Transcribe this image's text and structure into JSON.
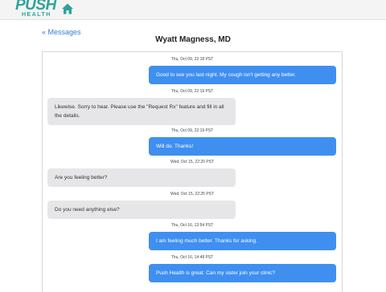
{
  "header": {
    "logo_top": "PUSH",
    "logo_bottom": "HEALTH",
    "home_icon": "home-icon"
  },
  "nav": {
    "back_label": "« Messages"
  },
  "conversation": {
    "title": "Wyatt Magness, MD",
    "messages": [
      {
        "timestamp": "Thu, Oct 09, 22:18 PST",
        "direction": "sent",
        "text": "Good to see you last night. My cough isn't getting any better."
      },
      {
        "timestamp": "Thu, Oct 09, 22:19 PST",
        "direction": "received",
        "text": "Likewise. Sorry to hear. Please use the \"Request Rx\" feature and fill in all the details."
      },
      {
        "timestamp": "Thu, Oct 09, 22:19 PST",
        "direction": "sent",
        "text": "Will do. Thanks!"
      },
      {
        "timestamp": "Wed, Oct 15, 22:20 PST",
        "direction": "received",
        "text": "Are you feeling better?"
      },
      {
        "timestamp": "Wed, Oct 15, 22:25 PST",
        "direction": "received",
        "text": "Do you need anything else?"
      },
      {
        "timestamp": "Thu, Oct 16, 13:54 PST",
        "direction": "sent",
        "text": "I am feeling much better. Thanks for asking."
      },
      {
        "timestamp": "Thu, Oct 16, 14:48 PST",
        "direction": "sent",
        "text": "Push Health is great. Can my sister join your clinic?"
      }
    ]
  },
  "colors": {
    "brand": "#2fa39a",
    "link": "#3a7bd5",
    "sent_bubble": "#3f8ff0",
    "received_bubble": "#e6e6e8"
  }
}
